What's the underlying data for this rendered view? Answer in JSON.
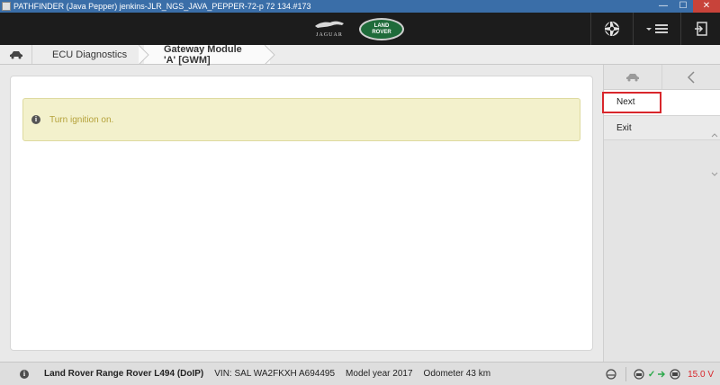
{
  "window": {
    "title": "PATHFINDER (Java Pepper) jenkins-JLR_NGS_JAVA_PEPPER-72-p 72 134.#173",
    "minimize_label": "—",
    "maximize_label": "☐",
    "close_label": "✕"
  },
  "header": {
    "jaguar_wordmark": "JAGUAR",
    "landrover_line1": "LAND",
    "landrover_line2": "ROVER",
    "icons": [
      "aperture-icon",
      "menu-icon",
      "logout-icon"
    ]
  },
  "breadcrumb": {
    "items": [
      {
        "label": "ECU Diagnostics"
      },
      {
        "label": "Gateway Module 'A' [GWM]"
      }
    ]
  },
  "main": {
    "banner_message": "Turn ignition on."
  },
  "sidebar": {
    "items": [
      {
        "label": "Next"
      },
      {
        "label": "Exit"
      }
    ]
  },
  "status": {
    "vehicle": "Land Rover Range Rover L494 (DoIP)",
    "vin": "VIN: SAL WA2FKXH A694495",
    "model_year": "Model year 2017",
    "odometer": "Odometer 43 km",
    "voltage": "15.0 V"
  },
  "colors": {
    "header_bg": "#1c1c1c",
    "banner_bg": "#f3f1cc",
    "banner_text": "#b5a23a",
    "highlight": "#d8262b",
    "status_ok": "#2aa84a",
    "voltage": "#d8262b"
  }
}
